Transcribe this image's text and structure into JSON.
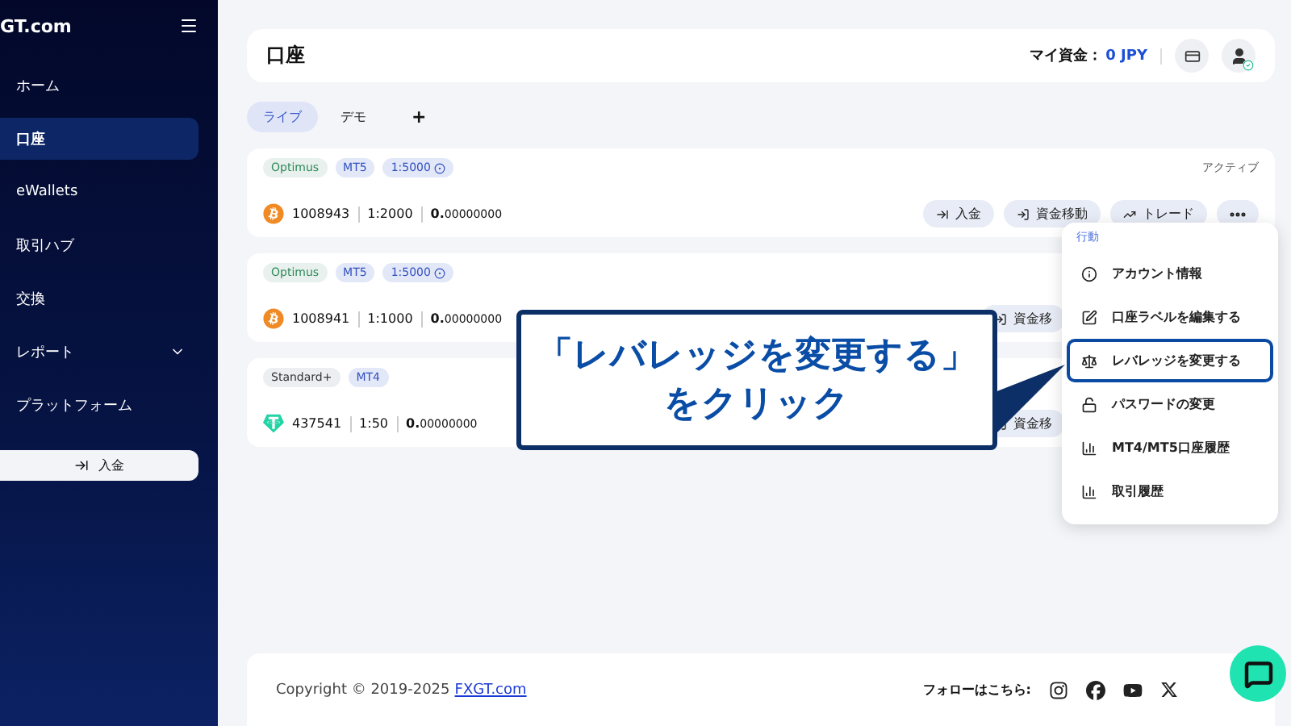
{
  "sidebar": {
    "logo": "GT.com",
    "items": [
      {
        "label": "ホーム",
        "selected": false,
        "expandable": false
      },
      {
        "label": "口座",
        "selected": true,
        "expandable": false
      },
      {
        "label": "eWallets",
        "selected": false,
        "expandable": false
      },
      {
        "label": "取引ハブ",
        "selected": false,
        "expandable": false
      },
      {
        "label": "交換",
        "selected": false,
        "expandable": false
      },
      {
        "label": "レポート",
        "selected": false,
        "expandable": true
      },
      {
        "label": "プラットフォーム",
        "selected": false,
        "expandable": false
      }
    ],
    "deposit_button": "入金"
  },
  "header": {
    "title": "口座",
    "balance_label": "マイ資金：",
    "balance_value": "0 JPY"
  },
  "tabs": [
    {
      "label": "ライブ",
      "selected": true
    },
    {
      "label": "デモ",
      "selected": false
    }
  ],
  "add_tab": "+",
  "accounts": [
    {
      "tags": [
        {
          "label": "Optimus",
          "kind": "type"
        },
        {
          "label": "MT5",
          "kind": "platform"
        },
        {
          "label": "1:5000",
          "kind": "leverage"
        }
      ],
      "kind": "bitcoin",
      "number": "1008943",
      "leverage": "1:2000",
      "balance_whole": "0.",
      "balance_fraction": "00000000",
      "status": "アクティブ",
      "actions": [
        {
          "kind": "deposit",
          "label": "入金"
        },
        {
          "kind": "transfer",
          "label": "資金移動"
        },
        {
          "kind": "trade",
          "label": "トレード"
        },
        {
          "kind": "more"
        }
      ]
    },
    {
      "tags": [
        {
          "label": "Optimus",
          "kind": "type"
        },
        {
          "label": "MT5",
          "kind": "platform"
        },
        {
          "label": "1:5000",
          "kind": "leverage"
        }
      ],
      "kind": "bitcoin",
      "number": "1008941",
      "leverage": "1:1000",
      "balance_whole": "0.",
      "balance_fraction": "00000000",
      "actions": [
        {
          "kind": "transfer",
          "label": "資金移"
        }
      ]
    },
    {
      "tags": [
        {
          "label": "Standard+",
          "kind": "type"
        },
        {
          "label": "MT4",
          "kind": "platform"
        }
      ],
      "kind": "tether",
      "number": "437541",
      "leverage": "1:50",
      "balance_whole": "0.",
      "balance_fraction": "00000000",
      "actions": [
        {
          "kind": "transfer",
          "label": "資金移"
        }
      ]
    }
  ],
  "menu": {
    "heading": "行動",
    "items": [
      {
        "label": "アカウント情報",
        "selected": false
      },
      {
        "label": "口座ラベルを編集する",
        "selected": false
      },
      {
        "label": "レバレッジを変更する",
        "selected": true
      },
      {
        "label": "パスワードの変更",
        "selected": false
      },
      {
        "label": "MT4/MT5口座履歴",
        "selected": false
      },
      {
        "label": "取引履歴",
        "selected": false
      }
    ]
  },
  "callout": {
    "lines": [
      "「レバレッジを変更する」",
      "をクリック"
    ]
  },
  "footer": {
    "copyright": "Copyright © 2019-2025",
    "link": "FXGT.com",
    "follow": "フォローはこちら:"
  }
}
